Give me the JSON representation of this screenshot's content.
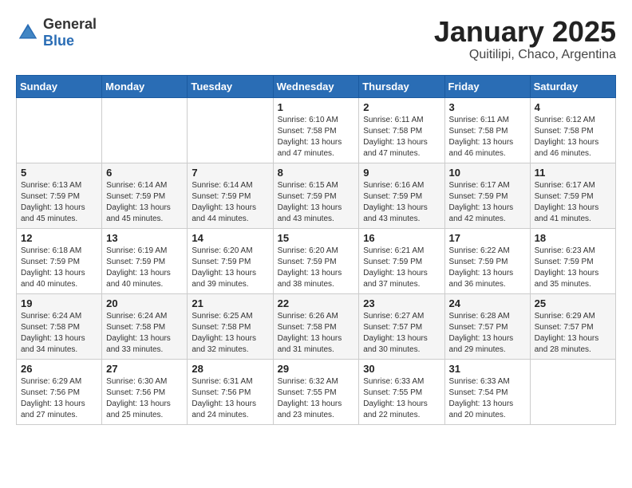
{
  "header": {
    "logo_general": "General",
    "logo_blue": "Blue",
    "month_title": "January 2025",
    "location": "Quitilipi, Chaco, Argentina"
  },
  "weekdays": [
    "Sunday",
    "Monday",
    "Tuesday",
    "Wednesday",
    "Thursday",
    "Friday",
    "Saturday"
  ],
  "weeks": [
    [
      {
        "day": "",
        "info": ""
      },
      {
        "day": "",
        "info": ""
      },
      {
        "day": "",
        "info": ""
      },
      {
        "day": "1",
        "info": "Sunrise: 6:10 AM\nSunset: 7:58 PM\nDaylight: 13 hours\nand 47 minutes."
      },
      {
        "day": "2",
        "info": "Sunrise: 6:11 AM\nSunset: 7:58 PM\nDaylight: 13 hours\nand 47 minutes."
      },
      {
        "day": "3",
        "info": "Sunrise: 6:11 AM\nSunset: 7:58 PM\nDaylight: 13 hours\nand 46 minutes."
      },
      {
        "day": "4",
        "info": "Sunrise: 6:12 AM\nSunset: 7:58 PM\nDaylight: 13 hours\nand 46 minutes."
      }
    ],
    [
      {
        "day": "5",
        "info": "Sunrise: 6:13 AM\nSunset: 7:59 PM\nDaylight: 13 hours\nand 45 minutes."
      },
      {
        "day": "6",
        "info": "Sunrise: 6:14 AM\nSunset: 7:59 PM\nDaylight: 13 hours\nand 45 minutes."
      },
      {
        "day": "7",
        "info": "Sunrise: 6:14 AM\nSunset: 7:59 PM\nDaylight: 13 hours\nand 44 minutes."
      },
      {
        "day": "8",
        "info": "Sunrise: 6:15 AM\nSunset: 7:59 PM\nDaylight: 13 hours\nand 43 minutes."
      },
      {
        "day": "9",
        "info": "Sunrise: 6:16 AM\nSunset: 7:59 PM\nDaylight: 13 hours\nand 43 minutes."
      },
      {
        "day": "10",
        "info": "Sunrise: 6:17 AM\nSunset: 7:59 PM\nDaylight: 13 hours\nand 42 minutes."
      },
      {
        "day": "11",
        "info": "Sunrise: 6:17 AM\nSunset: 7:59 PM\nDaylight: 13 hours\nand 41 minutes."
      }
    ],
    [
      {
        "day": "12",
        "info": "Sunrise: 6:18 AM\nSunset: 7:59 PM\nDaylight: 13 hours\nand 40 minutes."
      },
      {
        "day": "13",
        "info": "Sunrise: 6:19 AM\nSunset: 7:59 PM\nDaylight: 13 hours\nand 40 minutes."
      },
      {
        "day": "14",
        "info": "Sunrise: 6:20 AM\nSunset: 7:59 PM\nDaylight: 13 hours\nand 39 minutes."
      },
      {
        "day": "15",
        "info": "Sunrise: 6:20 AM\nSunset: 7:59 PM\nDaylight: 13 hours\nand 38 minutes."
      },
      {
        "day": "16",
        "info": "Sunrise: 6:21 AM\nSunset: 7:59 PM\nDaylight: 13 hours\nand 37 minutes."
      },
      {
        "day": "17",
        "info": "Sunrise: 6:22 AM\nSunset: 7:59 PM\nDaylight: 13 hours\nand 36 minutes."
      },
      {
        "day": "18",
        "info": "Sunrise: 6:23 AM\nSunset: 7:59 PM\nDaylight: 13 hours\nand 35 minutes."
      }
    ],
    [
      {
        "day": "19",
        "info": "Sunrise: 6:24 AM\nSunset: 7:58 PM\nDaylight: 13 hours\nand 34 minutes."
      },
      {
        "day": "20",
        "info": "Sunrise: 6:24 AM\nSunset: 7:58 PM\nDaylight: 13 hours\nand 33 minutes."
      },
      {
        "day": "21",
        "info": "Sunrise: 6:25 AM\nSunset: 7:58 PM\nDaylight: 13 hours\nand 32 minutes."
      },
      {
        "day": "22",
        "info": "Sunrise: 6:26 AM\nSunset: 7:58 PM\nDaylight: 13 hours\nand 31 minutes."
      },
      {
        "day": "23",
        "info": "Sunrise: 6:27 AM\nSunset: 7:57 PM\nDaylight: 13 hours\nand 30 minutes."
      },
      {
        "day": "24",
        "info": "Sunrise: 6:28 AM\nSunset: 7:57 PM\nDaylight: 13 hours\nand 29 minutes."
      },
      {
        "day": "25",
        "info": "Sunrise: 6:29 AM\nSunset: 7:57 PM\nDaylight: 13 hours\nand 28 minutes."
      }
    ],
    [
      {
        "day": "26",
        "info": "Sunrise: 6:29 AM\nSunset: 7:56 PM\nDaylight: 13 hours\nand 27 minutes."
      },
      {
        "day": "27",
        "info": "Sunrise: 6:30 AM\nSunset: 7:56 PM\nDaylight: 13 hours\nand 25 minutes."
      },
      {
        "day": "28",
        "info": "Sunrise: 6:31 AM\nSunset: 7:56 PM\nDaylight: 13 hours\nand 24 minutes."
      },
      {
        "day": "29",
        "info": "Sunrise: 6:32 AM\nSunset: 7:55 PM\nDaylight: 13 hours\nand 23 minutes."
      },
      {
        "day": "30",
        "info": "Sunrise: 6:33 AM\nSunset: 7:55 PM\nDaylight: 13 hours\nand 22 minutes."
      },
      {
        "day": "31",
        "info": "Sunrise: 6:33 AM\nSunset: 7:54 PM\nDaylight: 13 hours\nand 20 minutes."
      },
      {
        "day": "",
        "info": ""
      }
    ]
  ]
}
